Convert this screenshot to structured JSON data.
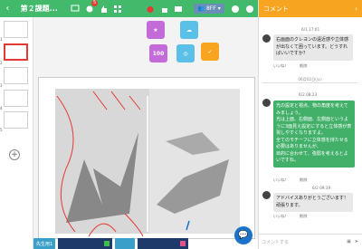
{
  "header": {
    "title": "第２課題...",
    "badge_count": "5",
    "user_label": "8FF",
    "brand_color": "#42b96b"
  },
  "left_rail": {
    "page_numbers": [
      "1",
      "2",
      "3",
      "4",
      "5"
    ],
    "active_page": 2
  },
  "stamps": [
    {
      "name": "stamp-good",
      "label": "",
      "color": "#c36bd8"
    },
    {
      "name": "stamp-idea",
      "label": "",
      "color": "#5bc0e8"
    },
    {
      "name": "stamp-100",
      "label": "100",
      "color": "#c36bd8"
    },
    {
      "name": "stamp-think",
      "label": "",
      "color": "#5bc0e8"
    },
    {
      "name": "stamp-effort",
      "label": "",
      "color": "#f7a421"
    }
  ],
  "bottom": {
    "chip1": "先生用1",
    "chip2": "",
    "chip3": ""
  },
  "panel": {
    "title": "コメント",
    "messages": [
      {
        "date": "6/1 17:01",
        "text": "右画面のクレヨンの遠近感や立体感が出なくて困っています。どうすればいいですか？",
        "likes": "いいね！",
        "delete": "削除",
        "style": "gray"
      },
      {
        "date": "6/2 08:23",
        "text": "光の設定と視点、物の角度を考えてみましょう。\n光は上面、右側面、左側面というように3面見え設定にすると立体感が表現しやすくなりますよ。\n全てのモチーフに立体感を持たせる必要はありませんが、\n目的に合わせて、強弱を考えるとよいですね。",
        "likes": "いいね！",
        "delete": "削除",
        "style": "green"
      },
      {
        "date": "6/2 09:39",
        "text": "アドバイスありがとうございます！頑張ります。",
        "likes": "いいね！",
        "delete": "削除",
        "style": "gray"
      }
    ],
    "date_separator": "06月02日(火)",
    "input_placeholder": "コメントする"
  }
}
